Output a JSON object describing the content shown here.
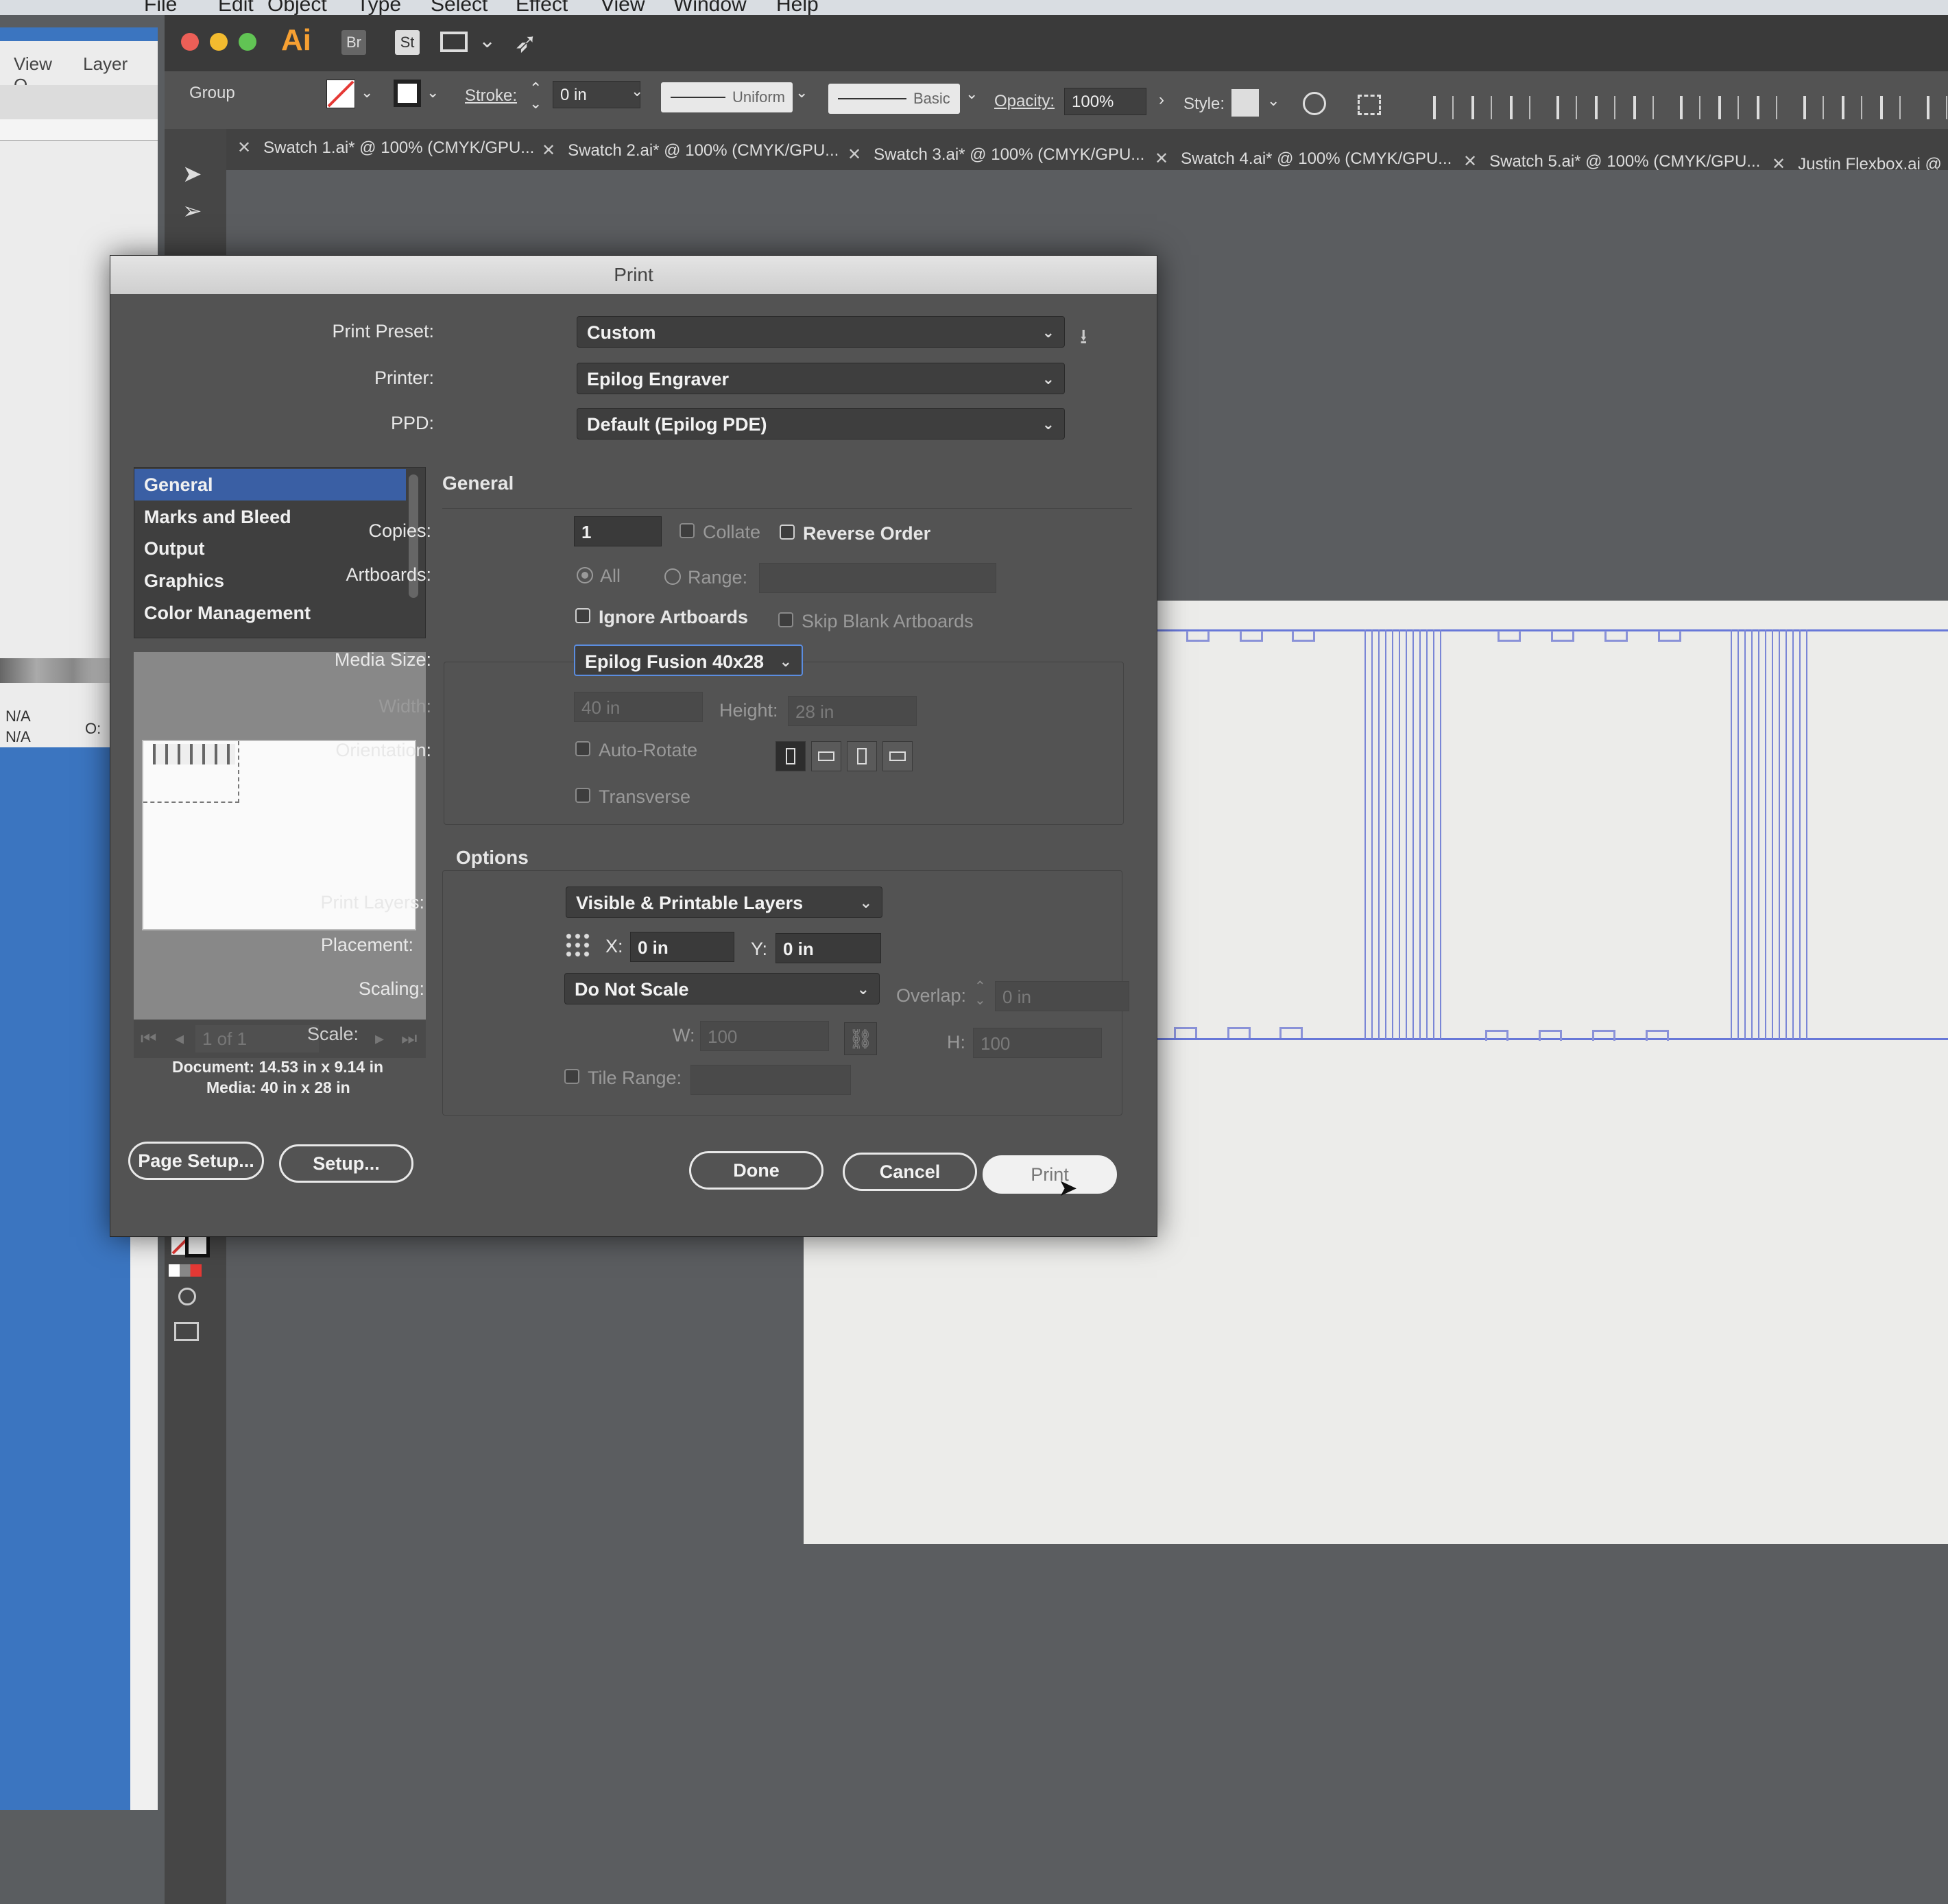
{
  "mac_menu": [
    "File",
    "Edit",
    "Object",
    "Type",
    "Select",
    "Effect",
    "View",
    "Window",
    "Help"
  ],
  "app": {
    "logo": "Ai",
    "bridge": "Br",
    "stock": "St"
  },
  "left_panel": {
    "menu": [
      "View",
      "Layer"
    ],
    "menu_trunc": "O",
    "na1": "N/A",
    "na2": "N/A",
    "o_label": "O:"
  },
  "control_bar": {
    "group": "Group",
    "stroke_label": "Stroke:",
    "stroke_value": "0 in",
    "uniform": "Uniform",
    "basic": "Basic",
    "opacity_label": "Opacity:",
    "opacity_value": "100%",
    "style_label": "Style:"
  },
  "tabs": [
    "Swatch 1.ai* @ 100% (CMYK/GPU...",
    "Swatch 2.ai* @ 100% (CMYK/GPU...",
    "Swatch 3.ai* @ 100% (CMYK/GPU...",
    "Swatch 4.ai* @ 100% (CMYK/GPU...",
    "Swatch 5.ai* @ 100% (CMYK/GPU...",
    "Justin Flexbox.ai @"
  ],
  "dialog": {
    "title": "Print",
    "print_preset_label": "Print Preset:",
    "print_preset_value": "Custom",
    "printer_label": "Printer:",
    "printer_value": "Epilog Engraver",
    "ppd_label": "PPD:",
    "ppd_value": "Default (Epilog PDE)",
    "categories": [
      "General",
      "Marks and Bleed",
      "Output",
      "Graphics",
      "Color Management"
    ],
    "section_general": "General",
    "copies_label": "Copies:",
    "copies_value": "1",
    "collate": "Collate",
    "reverse_order": "Reverse Order",
    "artboards_label": "Artboards:",
    "all": "All",
    "range": "Range:",
    "ignore_artboards": "Ignore Artboards",
    "skip_blank": "Skip Blank Artboards",
    "media_size_label": "Media Size:",
    "media_size_value": "Epilog Fusion 40x28",
    "width_label": "Width:",
    "width_value": "40 in",
    "height_label": "Height:",
    "height_value": "28 in",
    "orientation_label": "Orientation:",
    "auto_rotate": "Auto-Rotate",
    "transverse": "Transverse",
    "section_options": "Options",
    "print_layers_label": "Print Layers:",
    "print_layers_value": "Visible & Printable Layers",
    "placement_label": "Placement:",
    "x_label": "X:",
    "x_value": "0 in",
    "y_label": "Y:",
    "y_value": "0 in",
    "scaling_label": "Scaling:",
    "scaling_value": "Do Not Scale",
    "overlap_label": "Overlap:",
    "overlap_value": "0 in",
    "scale_label": "Scale:",
    "w_label": "W:",
    "w_value": "100",
    "h_label": "H:",
    "h_value": "100",
    "tile_range": "Tile Range:",
    "page_nav": "1 of 1",
    "document_info": "Document: 14.53 in x 9.14 in",
    "media_info": "Media: 40 in x 28 in",
    "page_setup": "Page Setup...",
    "setup": "Setup...",
    "done": "Done",
    "cancel": "Cancel",
    "print": "Print"
  },
  "colors": {
    "accent": "#3a5fa4",
    "cut_lines": "#6878d8",
    "ai_orange": "#f7a032"
  }
}
